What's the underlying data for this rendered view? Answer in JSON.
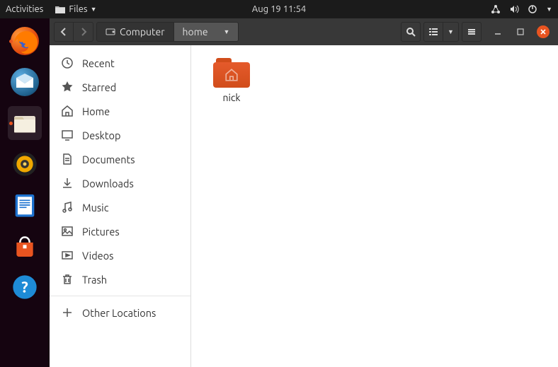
{
  "topbar": {
    "activities": "Activities",
    "app": "Files",
    "clock": "Aug 19  11:54"
  },
  "path": {
    "root": "Computer",
    "current": "home"
  },
  "sidebar": {
    "items": [
      {
        "label": "Recent",
        "icon": "clock"
      },
      {
        "label": "Starred",
        "icon": "star"
      },
      {
        "label": "Home",
        "icon": "home"
      },
      {
        "label": "Desktop",
        "icon": "desktop"
      },
      {
        "label": "Documents",
        "icon": "doc"
      },
      {
        "label": "Downloads",
        "icon": "down"
      },
      {
        "label": "Music",
        "icon": "music"
      },
      {
        "label": "Pictures",
        "icon": "pic"
      },
      {
        "label": "Videos",
        "icon": "video"
      },
      {
        "label": "Trash",
        "icon": "trash"
      }
    ],
    "other": "Other Locations"
  },
  "files": [
    {
      "name": "nick",
      "kind": "home-folder"
    }
  ]
}
